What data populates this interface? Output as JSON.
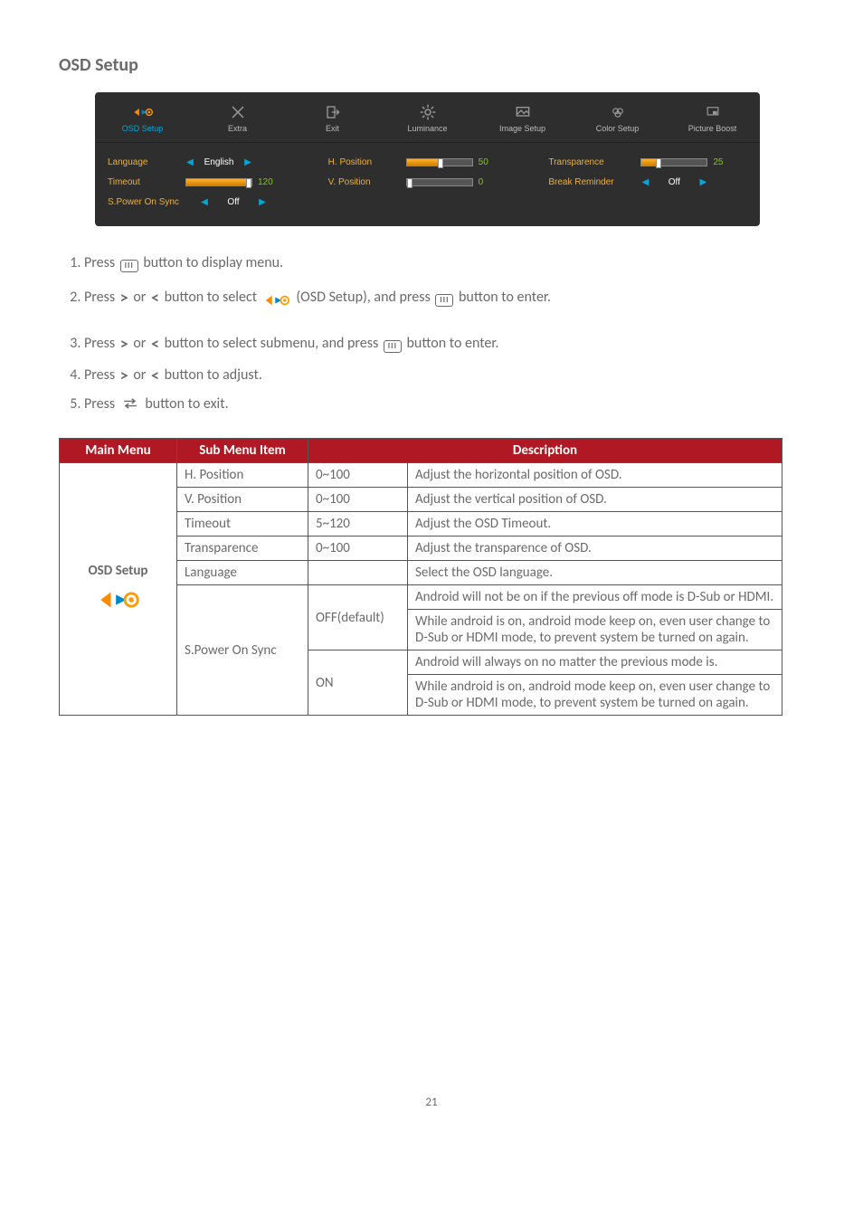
{
  "pageTitle": "OSD Setup",
  "pageNumber": "21",
  "osd_tabs": [
    {
      "label": "OSD Setup",
      "active": true
    },
    {
      "label": "Extra",
      "active": false
    },
    {
      "label": "Exit",
      "active": false
    },
    {
      "label": "Luminance",
      "active": false
    },
    {
      "label": "Image Setup",
      "active": false
    },
    {
      "label": "Color Setup",
      "active": false
    },
    {
      "label": "Picture Boost",
      "active": false
    }
  ],
  "osd_cols": {
    "c1": {
      "r1": {
        "label": "Language",
        "value": "English"
      },
      "r2": {
        "label": "Timeout",
        "value": "120",
        "fillPct": 96,
        "handlePct": 96
      },
      "r3": {
        "label": "S.Power On Sync",
        "value": "Off"
      }
    },
    "c2": {
      "r1": {
        "label": "H. Position",
        "value": "50",
        "fillPct": 50,
        "handlePct": 50
      },
      "r2": {
        "label": "V. Position",
        "value": "0",
        "fillPct": 0,
        "handlePct": 0
      }
    },
    "c3": {
      "r1": {
        "label": "Transparence",
        "value": "25",
        "fillPct": 25,
        "handlePct": 25
      },
      "r2": {
        "label": "Break Reminder",
        "value": "Off"
      }
    }
  },
  "instructions": {
    "s1a": "Press ",
    "s1b": " button to display menu.",
    "s2a": "Press ",
    "s2_or": " or ",
    "s2b": " button to select ",
    "s2c": " (OSD Setup), and press ",
    "s2d": " button to enter.",
    "s3a": "Press ",
    "s3b": " button to select submenu, and press ",
    "s3c": " button to enter.",
    "s4a": "Press ",
    "s4b": " button to adjust.",
    "s5a": "Press ",
    "s5b": " button to exit."
  },
  "tableHeaders": {
    "c1": "Main Menu",
    "c2": "Sub Menu Item",
    "c3": "",
    "c4": "Description"
  },
  "mainMenuLabel": "OSD Setup",
  "rows": {
    "hpos": {
      "sub": "H. Position",
      "range": "0~100",
      "desc": "Adjust the horizontal position of OSD."
    },
    "vpos": {
      "sub": "V. Position",
      "range": "0~100",
      "desc": "Adjust the vertical position of OSD."
    },
    "timeout": {
      "sub": "Timeout",
      "range": "5~120",
      "desc": "Adjust the OSD Timeout."
    },
    "transp": {
      "sub": "Transparence",
      "range": "0~100",
      "desc": "Adjust the transparence of OSD."
    },
    "lang": {
      "sub": "Language",
      "range": "",
      "desc": "Select the OSD language."
    },
    "spower": {
      "sub": "S.Power On Sync",
      "off": {
        "label": "OFF(default)",
        "d1": "Android will not be on if the previous off mode is D-Sub or HDMI.",
        "d2": "While android is on, android mode keep on, even user change to D-Sub or HDMI mode, to prevent system be turned on again."
      },
      "on": {
        "label": "ON",
        "d1": "Android will always on no matter the previous mode is.",
        "d2": "While android is on, android mode keep on, even user change to D-Sub or HDMI mode, to prevent system be turned on again."
      }
    }
  }
}
